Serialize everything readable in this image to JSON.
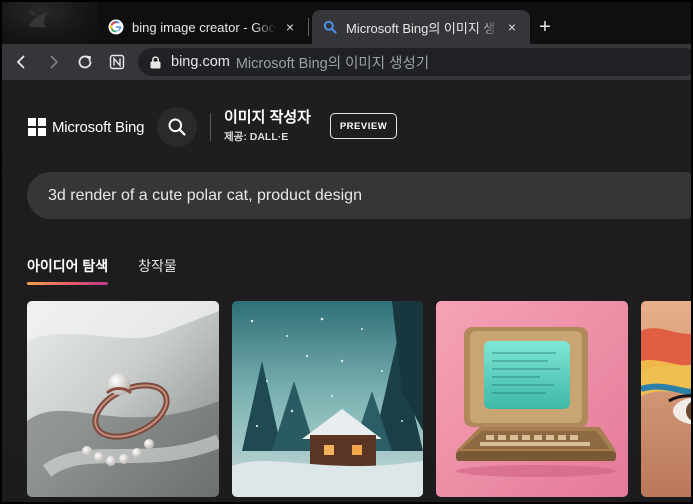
{
  "browser": {
    "tabs": [
      {
        "title": "bing image creator - Google",
        "favicon": "google-g-icon",
        "active": false
      },
      {
        "title": "Microsoft Bing의 이미지 생성기",
        "favicon": "bing-search-icon",
        "active": true
      }
    ],
    "close_glyph": "×",
    "new_tab_glyph": "+",
    "address": {
      "domain": "bing.com",
      "path": "Microsoft Bing의 이미지 생성기"
    }
  },
  "header": {
    "brand": "Microsoft Bing",
    "product_title": "이미지 작성자",
    "provider": "제공: DALL·E",
    "preview_label": "PREVIEW"
  },
  "prompt": {
    "value": "3d render of a cute polar cat, product design"
  },
  "page_tabs": [
    {
      "label": "아이디어 탐색",
      "selected": true
    },
    {
      "label": "창작물",
      "selected": false
    }
  ],
  "gallery": [
    {
      "subject": "silver ring with pearl on white fabric"
    },
    {
      "subject": "snowy cabin in winter forest at night"
    },
    {
      "subject": "retro computer terminal with green screen on pink background"
    },
    {
      "subject": "close-up of eye with colorful makeup"
    }
  ],
  "colors": {
    "page_bg": "#1e1c1e",
    "tab_underline_start": "#f3a24a",
    "tab_underline_end": "#b63a86",
    "prompt_bg": "#373538",
    "toolbar_bg": "#35363a"
  }
}
